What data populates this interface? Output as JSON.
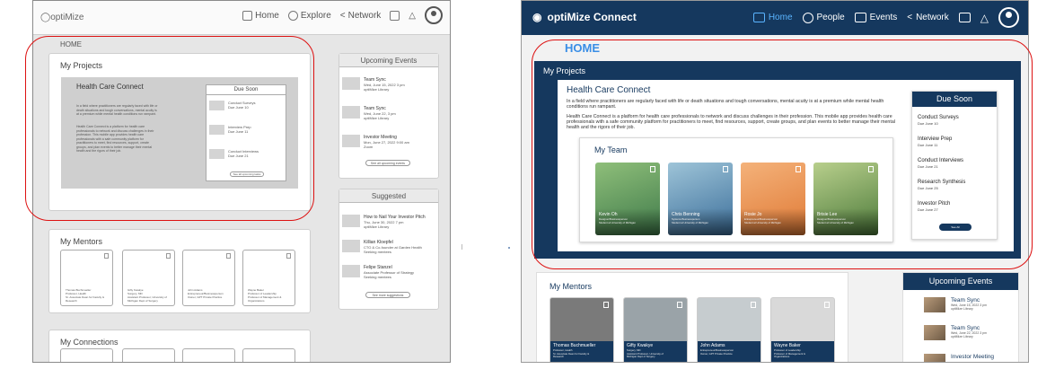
{
  "wireframe": {
    "logo": "optiMize",
    "nav": {
      "home": "Home",
      "explore": "Explore",
      "network": "Network"
    },
    "breadcrumb": "HOME",
    "my_projects": {
      "title": "My Projects",
      "project_title": "Health Care Connect",
      "para1": "In a field where practitioners are regularly faced with life or death situations and tough conversations, mental acuity is at a premium while mental health conditions run rampant.",
      "para2": "Health Care Connect is a platform for health care professionals to network and discuss challenges in their profession. This mobile app provides health care professionals with a safe community platform for practitioners to meet, find resources, support, create groups, and plan events to better manage their mental health and the rigors of their job."
    },
    "due_soon": {
      "title": "Due Soon",
      "items": [
        {
          "t": "Conduct Surveys",
          "s": "Due June 10"
        },
        {
          "t": "Interview Prep",
          "s": "Due June 11"
        },
        {
          "t": "Conduct Interviews",
          "s": "Due June 21"
        }
      ],
      "see_all": "See all upcoming tasks"
    },
    "upcoming": {
      "title": "Upcoming Events",
      "items": [
        {
          "t": "Team Sync",
          "s1": "Wed, June 15, 2022 3 pm",
          "s2": "optiMize Library"
        },
        {
          "t": "Team Sync",
          "s1": "Wed, June 22, 3 pm",
          "s2": "optiMize Library"
        },
        {
          "t": "Investor Meeting",
          "s1": "Mon, June 27, 2022 9:00 am",
          "s2": "Zoom"
        }
      ],
      "more": "See all upcoming events"
    },
    "suggested": {
      "title": "Suggested",
      "items": [
        {
          "t": "How to Nail Your Investor Pitch",
          "s1": "Thu, June 30, 2022 7 pm",
          "s2": "optiMize Library"
        },
        {
          "t": "Killian Kloepfel",
          "s1": "CTO & Co-founder at Garden Health",
          "s2": "Seeking mentees"
        },
        {
          "t": "Felipe Stanzel",
          "s1": "Associate Professor of Strategy",
          "s2": "Seeking mentees"
        }
      ],
      "more": "See more suggestions"
    },
    "mentors": {
      "title": "My Mentors",
      "items": [
        {
          "l1": "Thomas Buchmueller",
          "l2": "Professor, Health",
          "l3": "Sr. Associate Dean for Faculty &",
          "l4": "Research"
        },
        {
          "l1": "Gifty Kwakye",
          "l2": "Surgery, MD",
          "l3": "Assistant Professor, University of",
          "l4": "Michigan Dept of Surgery"
        },
        {
          "l1": "John Adams",
          "l2": "Entrepreneur/Businessperson",
          "l3": "Owner, GPT Private Practice",
          "l4": ""
        },
        {
          "l1": "Wayne Baker",
          "l2": "Professor of Leadership",
          "l3": "Professor of Management &",
          "l4": "Organizations"
        }
      ]
    },
    "connections": {
      "title": "My Connections"
    }
  },
  "hifi": {
    "brand": "optiMize Connect",
    "nav": {
      "home": "Home",
      "people": "People",
      "events": "Events",
      "network": "Network"
    },
    "home_label": "HOME",
    "my_projects": {
      "title": "My Projects",
      "project_title": "Health Care Connect",
      "para1": "In a field where practitioners are regularly faced with life or death situations and tough conversations, mental acuity is at a premium while mental health conditions run rampant.",
      "para2": "Health Care Connect is a platform for health care professionals to network and discuss challenges in their profession. This mobile app provides health care professionals with a safe community platform for practitioners to meet, find resources, support, create groups, and plan events to better manage their mental health and the rigors of their job."
    },
    "team": {
      "title": "My Team",
      "members": [
        {
          "name": "Kevin Oh",
          "r1": "Designer/Businessperson",
          "r2": "Student at University of Michigan",
          "color1": "#3f7a4a",
          "color2": "#8fbf7a"
        },
        {
          "name": "Chris Benning",
          "r1": "Systems Businessperson",
          "r2": "Student at University of Michigan",
          "color1": "#3b6e9a",
          "color2": "#9ec4d8"
        },
        {
          "name": "Rosie Jo",
          "r1": "Entrepreneur/Businessperson",
          "r2": "Student at University of Michigan",
          "color1": "#e07a36",
          "color2": "#f4b27a"
        },
        {
          "name": "Brisie Lee",
          "r1": "Designer/Businessperson",
          "r2": "Student at University of Michigan",
          "color1": "#4c7a3a",
          "color2": "#b8cf8c"
        }
      ]
    },
    "due_soon": {
      "title": "Due Soon",
      "items": [
        {
          "t": "Conduct Surveys",
          "s": "Due June 10"
        },
        {
          "t": "Interview Prep",
          "s": "Due June 11"
        },
        {
          "t": "Conduct Interviews",
          "s": "Due June 21"
        },
        {
          "t": "Research Synthesis",
          "s": "Due June 25"
        },
        {
          "t": "Investor Pitch",
          "s": "Due June 27"
        }
      ],
      "see_all": "See All"
    },
    "mentors": {
      "title": "My Mentors",
      "items": [
        {
          "name": "Thomas Buchmueller",
          "r1": "Professor, Health",
          "r2": "Sr. Associate Dean for Faculty &",
          "r3": "Research",
          "bg": "#7a7a7a"
        },
        {
          "name": "Gifty Kwakye",
          "r1": "Surgery, MD",
          "r2": "Assistant Professor, University of",
          "r3": "Michigan Dept of Surgery",
          "bg": "#9aa3a8"
        },
        {
          "name": "John Adams",
          "r1": "Entrepreneur/Businessperson",
          "r2": "Owner, GPT Private Practice",
          "r3": "",
          "bg": "#c6cccf"
        },
        {
          "name": "Wayne Baker",
          "r1": "Professor of Leadership",
          "r2": "Professor of Management &",
          "r3": "Organizations",
          "bg": "#d9d9d9"
        }
      ]
    },
    "upcoming": {
      "title": "Upcoming Events",
      "items": [
        {
          "t": "Team Sync",
          "s1": "Wed, June 15, 2022 3 pm",
          "s2": "optiMize Library"
        },
        {
          "t": "Team Sync",
          "s1": "Wed, June 22, 2022 3 pm",
          "s2": "optiMize Library"
        },
        {
          "t": "Investor Meeting",
          "s1": "",
          "s2": ""
        }
      ]
    }
  },
  "colors": {
    "navy": "#15385e",
    "active_blue": "#5ab4ff",
    "home_blue": "#3a8ee6",
    "annotation_red": "#d11111"
  }
}
